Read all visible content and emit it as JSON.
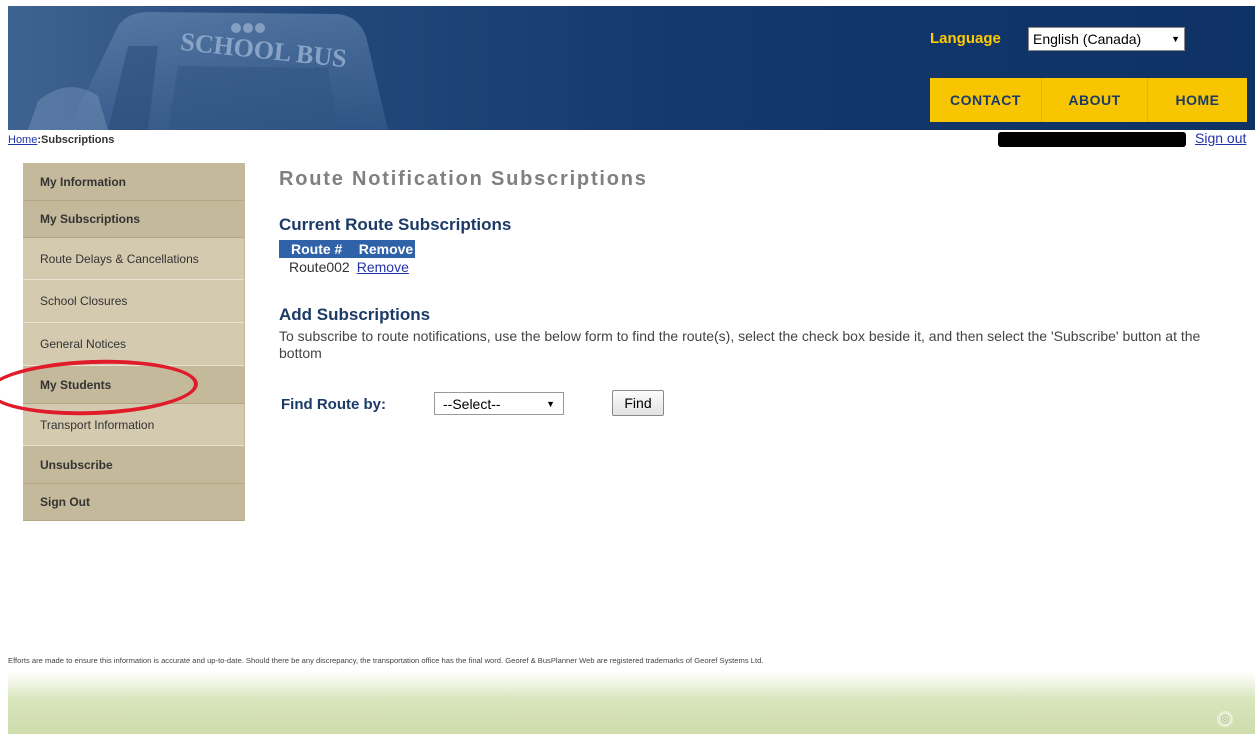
{
  "header": {
    "bus_text": "SCHOOL BUS",
    "language_label": "Language",
    "language_value": "English (Canada)",
    "nav": [
      {
        "label": "CONTACT"
      },
      {
        "label": "ABOUT"
      },
      {
        "label": "HOME"
      }
    ]
  },
  "breadcrumb": {
    "home": "Home",
    "separator": ":",
    "current": "Subscriptions"
  },
  "signout_label": "Sign out",
  "sidebar": {
    "items": [
      {
        "label": "My Information"
      },
      {
        "label": "My Subscriptions"
      },
      {
        "label": "Route Delays & Cancellations"
      },
      {
        "label": "School Closures"
      },
      {
        "label": "General Notices"
      },
      {
        "label": "My Students"
      },
      {
        "label": "Transport Information"
      },
      {
        "label": "Unsubscribe"
      },
      {
        "label": "Sign Out"
      }
    ]
  },
  "main": {
    "page_title": "Route Notification Subscriptions",
    "current_title": "Current Route Subscriptions",
    "table": {
      "headers": [
        "Route #",
        "Remove"
      ],
      "rows": [
        {
          "route": "Route002",
          "action": "Remove"
        }
      ]
    },
    "add_title": "Add Subscriptions",
    "add_description": "To subscribe to route notifications, use the below form to find the route(s), select the check box beside it, and then select the 'Subscribe' button at the bottom",
    "find_label": "Find Route by:",
    "find_select_value": "--Select--",
    "find_button": "Find"
  },
  "footer": {
    "disclaimer": "Efforts are made to ensure this information is accurate and up-to-date. Should there be any discrepancy, the transportation office has the final word. Georef & BusPlanner Web are registered trademarks of Georef Systems Ltd."
  },
  "colors": {
    "banner": "#14386c",
    "nav_bg": "#f7c600",
    "nav_text": "#1b3a66",
    "language_label": "#ffcc00",
    "table_header": "#2f62a8",
    "annotation": "#e01b2a",
    "footer_band": "#d9e5bb"
  },
  "icons": {
    "dropdown": "chevron-down-icon",
    "footer_logo": "georef-logo-icon"
  }
}
